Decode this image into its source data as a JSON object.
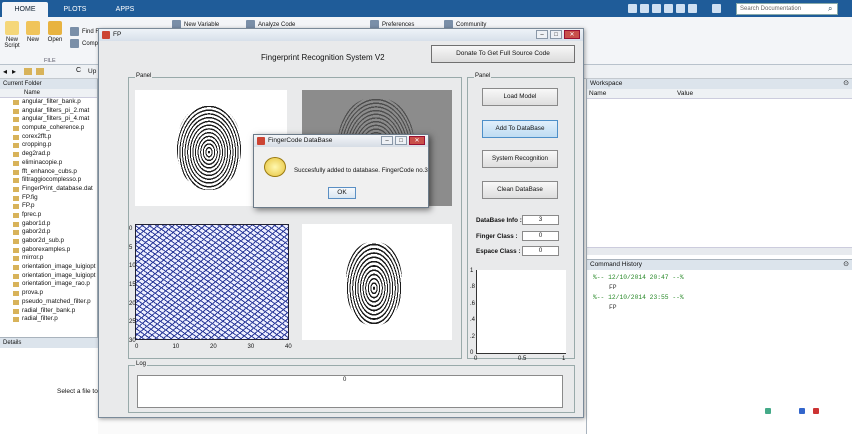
{
  "ribbon": {
    "tabs": [
      "HOME",
      "PLOTS",
      "APPS"
    ],
    "tools": {
      "new_script": "New\nScript",
      "new": "New",
      "open": "Open",
      "find_files": "Find File",
      "compare": "Compa",
      "file_group": "FILE",
      "new_variable": "New Variable",
      "analyze_code": "Analyze Code",
      "preferences": "Preferences",
      "community": "Community"
    },
    "search_placeholder": "Search Documentation"
  },
  "address": {
    "path": "Up"
  },
  "current_folder": {
    "title": "Current Folder",
    "column_name": "Name",
    "files": [
      "angular_filter_bank.p",
      "angular_filters_pi_2.mat",
      "angular_filters_pi_4.mat",
      "compute_coherence.p",
      "corex2fft.p",
      "cropping.p",
      "deg2rad.p",
      "eliminacopie.p",
      "fft_enhance_cubs.p",
      "filtraggiocomplesso.p",
      "FingerPrint_database.dat",
      "FP.fig",
      "FP.p",
      "fprec.p",
      "gabor1d.p",
      "gabor2d.p",
      "gabor2d_sub.p",
      "gaborexamples.p",
      "mirror.p",
      "orientation_image_luigiopt",
      "orientation_image_luigiopt",
      "orientation_image_rao.p",
      "prova.p",
      "pseudo_matched_filter.p",
      "radial_filter_bank.p",
      "radial_filter.p"
    ]
  },
  "details": {
    "title": "Details",
    "message": "Select a file to"
  },
  "workspace": {
    "title": "Workspace",
    "col_name": "Name",
    "col_value": "Value"
  },
  "command_history": {
    "title": "Command History",
    "entries": [
      {
        "header": "%-- 12/10/2014 20:47 --%",
        "cmd": "FP"
      },
      {
        "header": "%-- 12/10/2014 23:55 --%",
        "cmd": "FP"
      }
    ]
  },
  "fp_window": {
    "title": "FP",
    "app_title": "Fingerprint Recognition System V2",
    "donate_label": "Donate To Get Full Source Code",
    "panel_left_label": "Panel",
    "panel_right_label": "Panel",
    "buttons": {
      "load_model": "Load Model",
      "add_to_database": "Add To DataBase",
      "system_recognition": "System Recognition",
      "clean_database": "Clean DataBase"
    },
    "fields": {
      "database_info_label": "DataBase Info :",
      "database_info_value": "3",
      "finger_class_label": "Finger Class :",
      "finger_class_value": "0",
      "espace_class_label": "Espace Class :",
      "espace_class_value": "0"
    },
    "orientation_plot": {
      "y_ticks": [
        "0",
        "5",
        "10",
        "15",
        "20",
        "25",
        "30"
      ],
      "x_ticks": [
        "0",
        "10",
        "20",
        "30",
        "40"
      ]
    },
    "small_plot": {
      "y_ticks": [
        "1",
        ".8",
        ".6",
        ".4",
        ".2",
        "0"
      ],
      "x_ticks": [
        "0",
        "0.5",
        "1"
      ]
    },
    "log_label": "Log",
    "log_value": "0"
  },
  "dialog": {
    "title": "FingerCode DataBase",
    "message": "Succesfully added to database. FingerCode no.3",
    "ok_label": "OK"
  }
}
